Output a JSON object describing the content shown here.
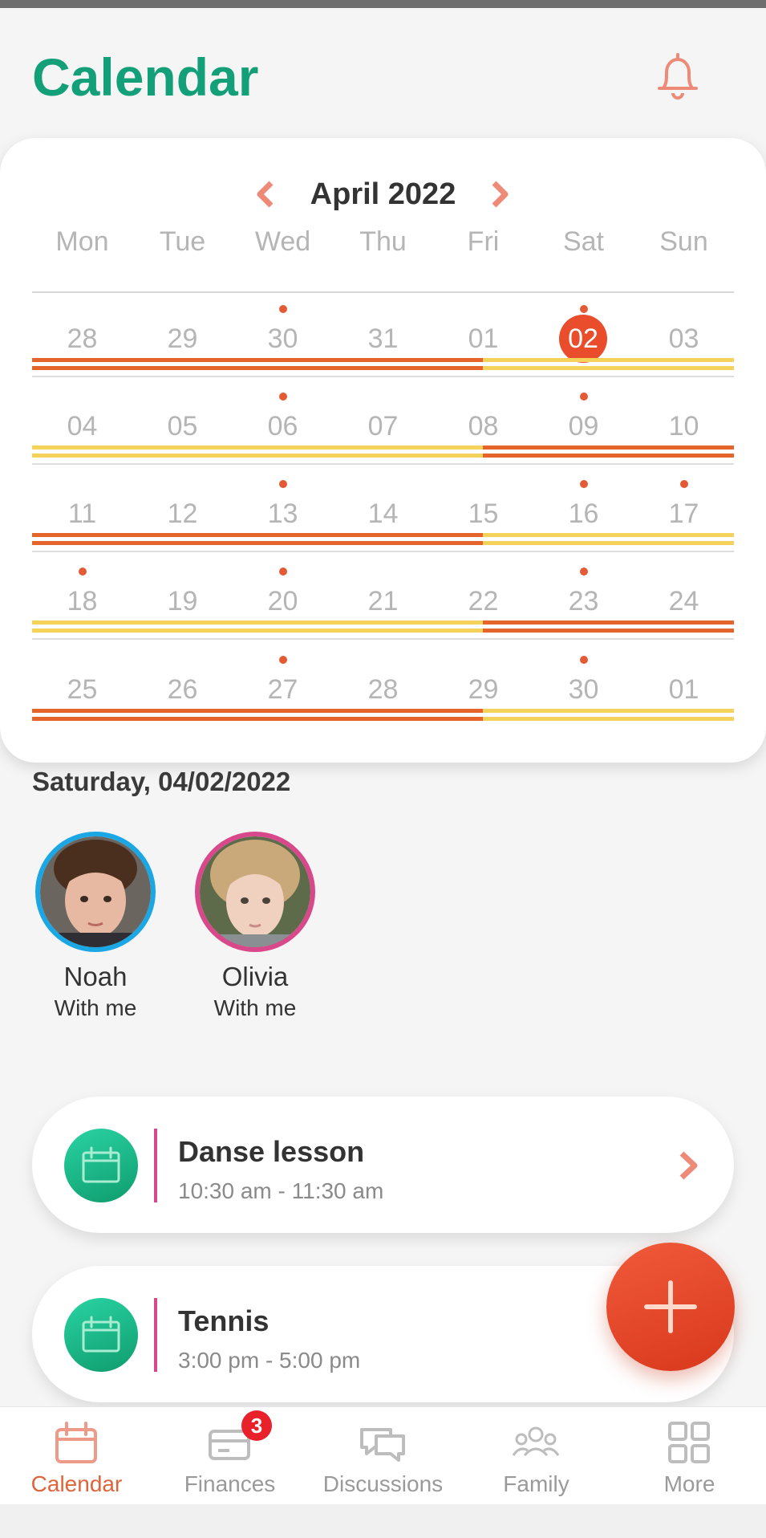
{
  "app": {
    "title": "Calendar",
    "accent": "#13a078",
    "primary_action": "#ea4d2c"
  },
  "calendar": {
    "month_label": "April 2022",
    "weekdays": [
      "Mon",
      "Tue",
      "Wed",
      "Thu",
      "Fri",
      "Sat",
      "Sun"
    ],
    "weeks": [
      {
        "days": [
          "28",
          "29",
          "30",
          "31",
          "01",
          "02",
          "03"
        ],
        "dots": [
          false,
          false,
          true,
          false,
          false,
          true,
          false
        ],
        "custody_split": "orange-then-yellow"
      },
      {
        "days": [
          "04",
          "05",
          "06",
          "07",
          "08",
          "09",
          "10"
        ],
        "dots": [
          false,
          false,
          true,
          false,
          false,
          true,
          false
        ],
        "custody_split": "yellow-then-orange"
      },
      {
        "days": [
          "11",
          "12",
          "13",
          "14",
          "15",
          "16",
          "17"
        ],
        "dots": [
          false,
          false,
          true,
          false,
          false,
          true,
          true
        ],
        "custody_split": "orange-then-yellow"
      },
      {
        "days": [
          "18",
          "19",
          "20",
          "21",
          "22",
          "23",
          "24"
        ],
        "dots": [
          true,
          false,
          true,
          false,
          false,
          true,
          false
        ],
        "custody_split": "yellow-then-orange"
      },
      {
        "days": [
          "25",
          "26",
          "27",
          "28",
          "29",
          "30",
          "01"
        ],
        "dots": [
          false,
          false,
          true,
          false,
          false,
          true,
          false
        ],
        "custody_split": "orange-then-yellow"
      }
    ],
    "selected_day": "02",
    "colors": {
      "parent_a": "#e4642c",
      "parent_b": "#f5d25a"
    }
  },
  "selected_date_label": "Saturday, 04/02/2022",
  "children": [
    {
      "name": "Noah",
      "status": "With me",
      "ring_color": "#1ba6e4"
    },
    {
      "name": "Olivia",
      "status": "With me",
      "ring_color": "#d8488a"
    }
  ],
  "events": [
    {
      "title": "Danse lesson",
      "time": "10:30 am - 11:30 am"
    },
    {
      "title": "Tennis",
      "time": "3:00 pm - 5:00 pm"
    }
  ],
  "tabs": [
    {
      "label": "Calendar",
      "icon": "calendar-icon",
      "active": true
    },
    {
      "label": "Finances",
      "icon": "wallet-icon",
      "badge": "3"
    },
    {
      "label": "Discussions",
      "icon": "chat-icon"
    },
    {
      "label": "Family",
      "icon": "family-icon"
    },
    {
      "label": "More",
      "icon": "grid-icon"
    }
  ]
}
